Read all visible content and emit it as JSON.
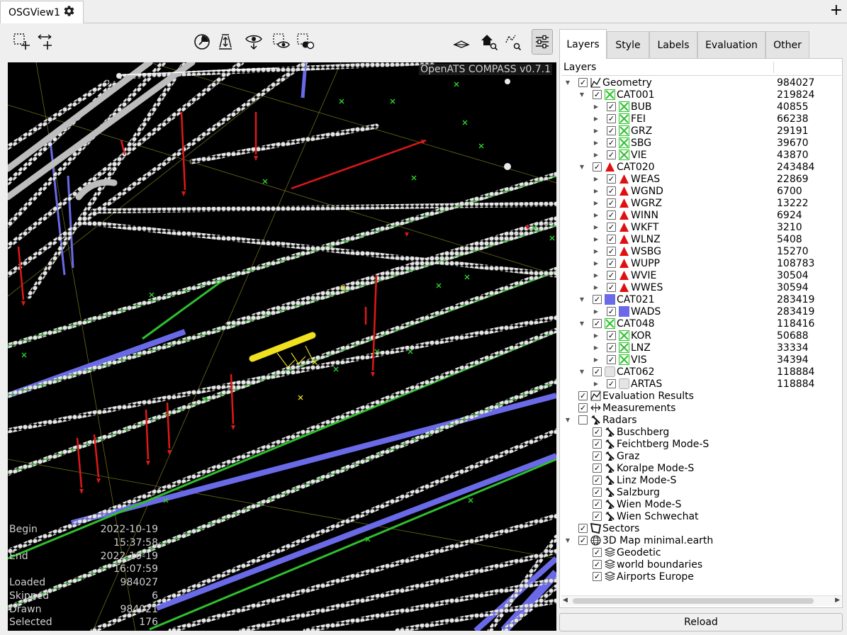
{
  "window": {
    "tab_title": "OSGView1"
  },
  "viewport": {
    "watermark": "OpenATS COMPASS v0.7.1",
    "stats": [
      {
        "label": "Begin",
        "value": "2022-10-19 15:37:58"
      },
      {
        "label": "End",
        "value": "2022-10-19 16:07:59"
      },
      {
        "label": "Loaded",
        "value": "984027"
      },
      {
        "label": "Skipped",
        "value": "6"
      },
      {
        "label": "Drawn",
        "value": "984021"
      },
      {
        "label": "Selected",
        "value": "176"
      }
    ]
  },
  "tabs": [
    "Layers",
    "Style",
    "Labels",
    "Evaluation",
    "Other"
  ],
  "active_tab": "Layers",
  "tree": {
    "header": "Layers",
    "nodes": [
      {
        "label": "Geometry",
        "count": "984027",
        "checked": true,
        "expanded": true,
        "icon": "geometry-icon"
      },
      {
        "label": "CAT001",
        "count": "219824",
        "checked": true,
        "expanded": true,
        "icon": "green-x-icon"
      },
      {
        "label": "BUB",
        "count": "40855",
        "checked": true,
        "icon": "green-x-icon"
      },
      {
        "label": "FEI",
        "count": "66238",
        "checked": true,
        "icon": "green-x-icon"
      },
      {
        "label": "GRZ",
        "count": "29191",
        "checked": true,
        "icon": "green-x-icon"
      },
      {
        "label": "SBG",
        "count": "39670",
        "checked": true,
        "icon": "green-x-icon"
      },
      {
        "label": "VIE",
        "count": "43870",
        "checked": true,
        "icon": "green-x-icon"
      },
      {
        "label": "CAT020",
        "count": "243484",
        "checked": true,
        "expanded": true,
        "icon": "red-triangle-icon"
      },
      {
        "label": "WEAS",
        "count": "22869",
        "checked": true,
        "icon": "red-triangle-icon"
      },
      {
        "label": "WGND",
        "count": "6700",
        "checked": true,
        "icon": "red-triangle-icon"
      },
      {
        "label": "WGRZ",
        "count": "13222",
        "checked": true,
        "icon": "red-triangle-icon"
      },
      {
        "label": "WINN",
        "count": "6924",
        "checked": true,
        "icon": "red-triangle-icon"
      },
      {
        "label": "WKFT",
        "count": "3210",
        "checked": true,
        "icon": "red-triangle-icon"
      },
      {
        "label": "WLNZ",
        "count": "5408",
        "checked": true,
        "icon": "red-triangle-icon"
      },
      {
        "label": "WSBG",
        "count": "15270",
        "checked": true,
        "icon": "red-triangle-icon"
      },
      {
        "label": "WUPP",
        "count": "108783",
        "checked": true,
        "icon": "red-triangle-icon"
      },
      {
        "label": "WVIE",
        "count": "30504",
        "checked": true,
        "icon": "red-triangle-icon"
      },
      {
        "label": "WWES",
        "count": "30594",
        "checked": true,
        "icon": "red-triangle-icon"
      },
      {
        "label": "CAT021",
        "count": "283419",
        "checked": true,
        "expanded": true,
        "icon": "blue-square-icon"
      },
      {
        "label": "WADS",
        "count": "283419",
        "checked": true,
        "icon": "blue-square-icon"
      },
      {
        "label": "CAT048",
        "count": "118416",
        "checked": true,
        "expanded": true,
        "icon": "green-x-icon"
      },
      {
        "label": "KOR",
        "count": "50688",
        "checked": true,
        "icon": "green-x-icon"
      },
      {
        "label": "LNZ",
        "count": "33334",
        "checked": true,
        "icon": "green-x-icon"
      },
      {
        "label": "VIS",
        "count": "34394",
        "checked": true,
        "icon": "green-x-icon"
      },
      {
        "label": "CAT062",
        "count": "118884",
        "checked": true,
        "expanded": true,
        "icon": "grey-circle-icon"
      },
      {
        "label": "ARTAS",
        "count": "118884",
        "checked": true,
        "icon": "grey-circle-icon"
      },
      {
        "label": "Evaluation Results",
        "count": "",
        "checked": true,
        "icon": "evaluation-icon"
      },
      {
        "label": "Measurements",
        "count": "",
        "checked": true,
        "icon": "measure-icon"
      },
      {
        "label": "Radars",
        "count": "",
        "checked": false,
        "expanded": true,
        "icon": "radar-icon"
      },
      {
        "label": "Buschberg",
        "count": "",
        "checked": true,
        "icon": "radar-icon"
      },
      {
        "label": "Feichtberg Mode-S",
        "count": "",
        "checked": true,
        "icon": "radar-icon"
      },
      {
        "label": "Graz",
        "count": "",
        "checked": true,
        "icon": "radar-icon"
      },
      {
        "label": "Koralpe Mode-S",
        "count": "",
        "checked": true,
        "icon": "radar-icon"
      },
      {
        "label": "Linz Mode-S",
        "count": "",
        "checked": true,
        "icon": "radar-icon"
      },
      {
        "label": "Salzburg",
        "count": "",
        "checked": true,
        "icon": "radar-icon"
      },
      {
        "label": "Wien Mode-S",
        "count": "",
        "checked": true,
        "icon": "radar-icon"
      },
      {
        "label": "Wien Schwechat",
        "count": "",
        "checked": true,
        "icon": "radar-icon"
      },
      {
        "label": "Sectors",
        "count": "",
        "checked": true,
        "icon": "sector-icon"
      },
      {
        "label": "3D Map minimal.earth",
        "count": "",
        "checked": true,
        "expanded": true,
        "icon": "globe-icon"
      },
      {
        "label": "Geodetic",
        "count": "",
        "checked": true,
        "icon": "layers-icon"
      },
      {
        "label": "world boundaries",
        "count": "",
        "checked": true,
        "icon": "layers-icon"
      },
      {
        "label": "Airports Europe",
        "count": "",
        "checked": true,
        "icon": "layers-icon"
      }
    ]
  },
  "reload_label": "Reload"
}
